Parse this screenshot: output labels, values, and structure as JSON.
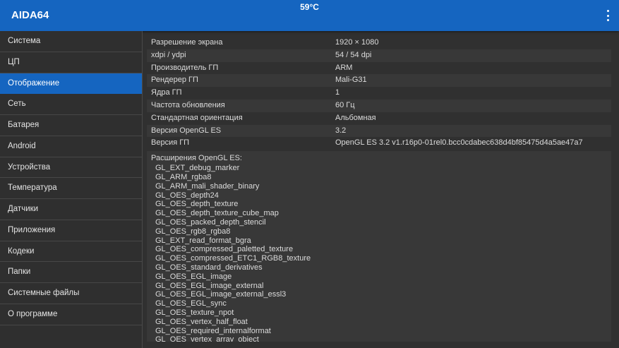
{
  "appbar": {
    "title": "AIDA64",
    "temperature": "59°C"
  },
  "sidebar": {
    "active_index": 2,
    "items": [
      {
        "label": "Система"
      },
      {
        "label": "ЦП"
      },
      {
        "label": "Отображение"
      },
      {
        "label": "Сеть"
      },
      {
        "label": "Батарея"
      },
      {
        "label": "Android"
      },
      {
        "label": "Устройства"
      },
      {
        "label": "Температура"
      },
      {
        "label": "Датчики"
      },
      {
        "label": "Приложения"
      },
      {
        "label": "Кодеки"
      },
      {
        "label": "Папки"
      },
      {
        "label": "Системные файлы"
      },
      {
        "label": "О программе"
      }
    ]
  },
  "display": {
    "rows": [
      {
        "key": "Разрешение экрана",
        "value": "1920 × 1080"
      },
      {
        "key": "xdpi / ydpi",
        "value": "54 / 54 dpi"
      },
      {
        "key": "Производитель ГП",
        "value": "ARM"
      },
      {
        "key": "Рендерер ГП",
        "value": "Mali-G31"
      },
      {
        "key": "Ядра ГП",
        "value": "1"
      },
      {
        "key": "Частота обновления",
        "value": "60 Гц"
      },
      {
        "key": "Стандартная ориентация",
        "value": "Альбомная"
      },
      {
        "key": "Версия OpenGL ES",
        "value": "3.2"
      },
      {
        "key": "Версия ГП",
        "value": "OpenGL ES 3.2 v1.r16p0-01rel0.bcc0cdabec638d4bf85475d4a5ae47a7"
      }
    ],
    "extensions_title": "Расширения OpenGL ES:",
    "extensions": [
      "GL_EXT_debug_marker",
      "GL_ARM_rgba8",
      "GL_ARM_mali_shader_binary",
      "GL_OES_depth24",
      "GL_OES_depth_texture",
      "GL_OES_depth_texture_cube_map",
      "GL_OES_packed_depth_stencil",
      "GL_OES_rgb8_rgba8",
      "GL_EXT_read_format_bgra",
      "GL_OES_compressed_paletted_texture",
      "GL_OES_compressed_ETC1_RGB8_texture",
      "GL_OES_standard_derivatives",
      "GL_OES_EGL_image",
      "GL_OES_EGL_image_external",
      "GL_OES_EGL_image_external_essl3",
      "GL_OES_EGL_sync",
      "GL_OES_texture_npot",
      "GL_OES_vertex_half_float",
      "GL_OES_required_internalformat",
      "GL_OES_vertex_array_object"
    ]
  },
  "colors": {
    "accent": "#1565c0",
    "background": "#303030"
  }
}
